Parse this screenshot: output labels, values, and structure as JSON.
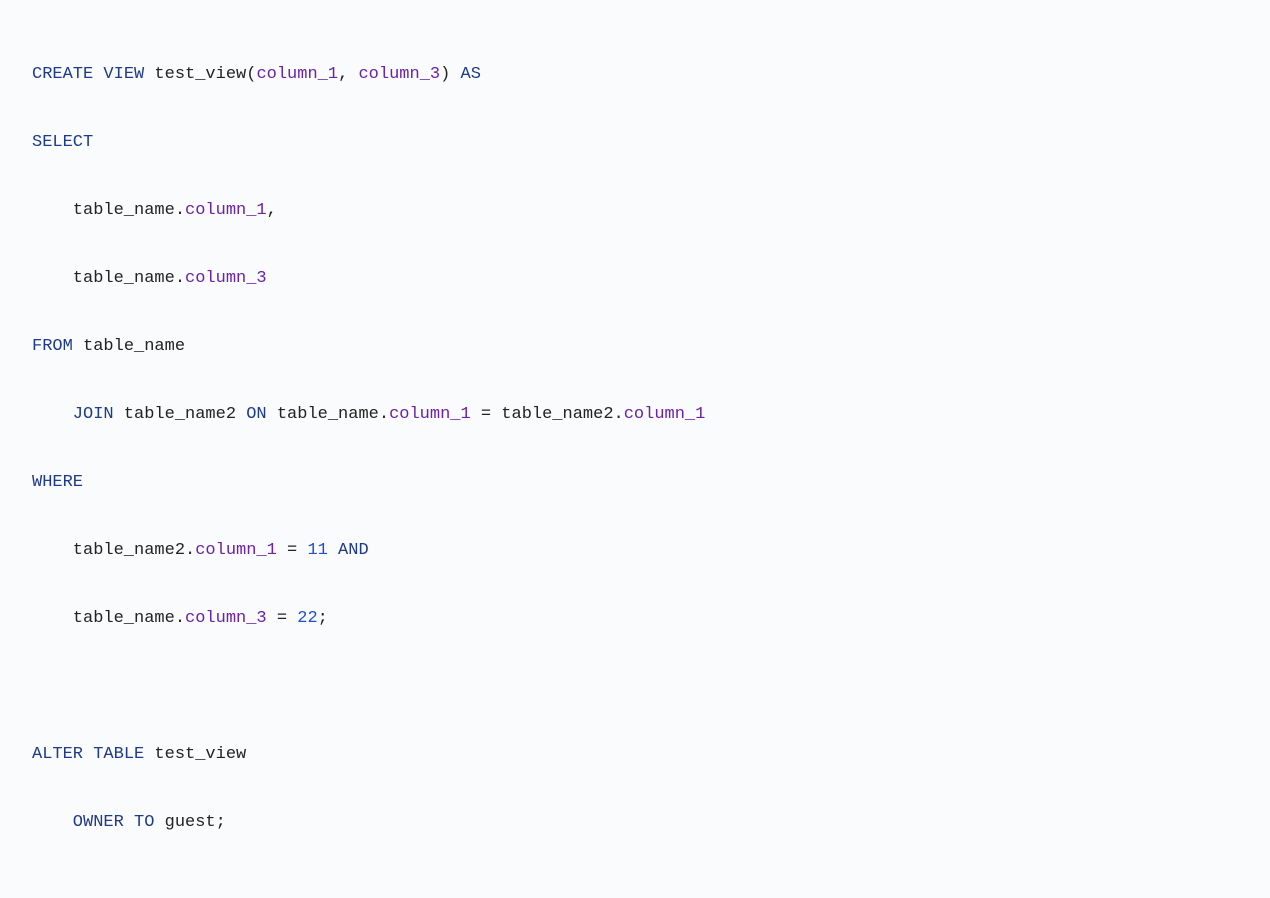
{
  "code": {
    "line1": {
      "kw1": "CREATE VIEW",
      "view_name": " test_view",
      "paren_open": "(",
      "col1": "column_1",
      "comma1": ", ",
      "col2": "column_3",
      "paren_close": ") ",
      "kw2": "AS"
    },
    "line2": {
      "kw": "SELECT"
    },
    "line3": {
      "tbl": "table_name.",
      "col": "column_1",
      "suffix": ","
    },
    "line4": {
      "tbl": "table_name.",
      "col": "column_3"
    },
    "line5": {
      "kw": "FROM",
      "tbl": " table_name"
    },
    "line6": {
      "kw": "JOIN",
      "tbl1": " table_name2 ",
      "on": "ON",
      "left_tbl": " table_name.",
      "left_col": "column_1",
      "eq": " = ",
      "right_tbl": "table_name2.",
      "right_col": "column_1"
    },
    "line7": {
      "kw": "WHERE"
    },
    "line8": {
      "tbl": "table_name2.",
      "col": "column_1",
      "eq": " = ",
      "val": "11",
      "and": " AND"
    },
    "line9": {
      "tbl": "table_name.",
      "col": "column_3",
      "eq": " = ",
      "val": "22",
      "semi": ";"
    },
    "line11": {
      "kw": "ALTER TABLE",
      "tbl": " test_view"
    },
    "line12": {
      "kw": "OWNER TO",
      "val": " guest",
      "semi": ";"
    }
  }
}
